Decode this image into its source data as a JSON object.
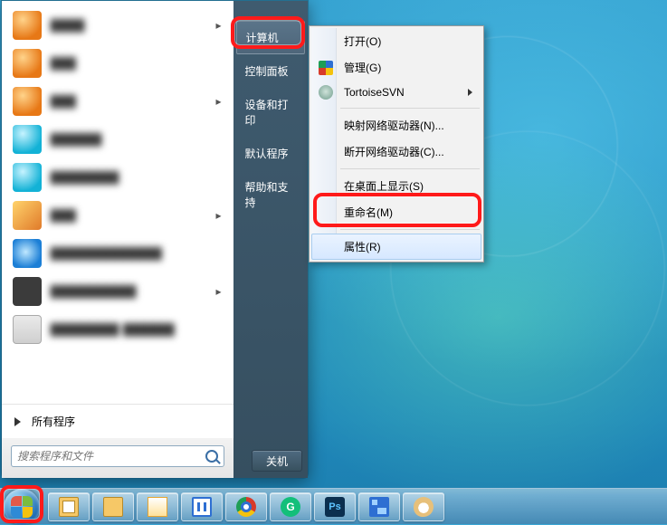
{
  "start_menu": {
    "all_programs_label": "所有程序",
    "search_placeholder": "搜索程序和文件",
    "shutdown_label": "关机",
    "right_items": [
      {
        "label": "计算机",
        "highlighted": true
      },
      {
        "label": "控制面板"
      },
      {
        "label": "设备和打印"
      },
      {
        "label": "默认程序"
      },
      {
        "label": "帮助和支持"
      }
    ]
  },
  "context_menu": {
    "open": "打开(O)",
    "manage": "管理(G)",
    "tortoisesvn": "TortoiseSVN",
    "map_drive": "映射网络驱动器(N)...",
    "unmap_drive": "断开网络驱动器(C)...",
    "show_desktop": "在桌面上显示(S)",
    "rename": "重命名(M)",
    "properties": "属性(R)"
  },
  "taskbar": {
    "items": [
      {
        "name": "libraries"
      },
      {
        "name": "explorer"
      },
      {
        "name": "outlook"
      },
      {
        "name": "maxthon"
      },
      {
        "name": "chrome"
      },
      {
        "name": "grammarly"
      },
      {
        "name": "photoshop"
      },
      {
        "name": "control-panel-app"
      },
      {
        "name": "paint"
      }
    ]
  },
  "highlights": {
    "computer_menu_item": true,
    "properties_menu_item": true,
    "start_button": true
  }
}
